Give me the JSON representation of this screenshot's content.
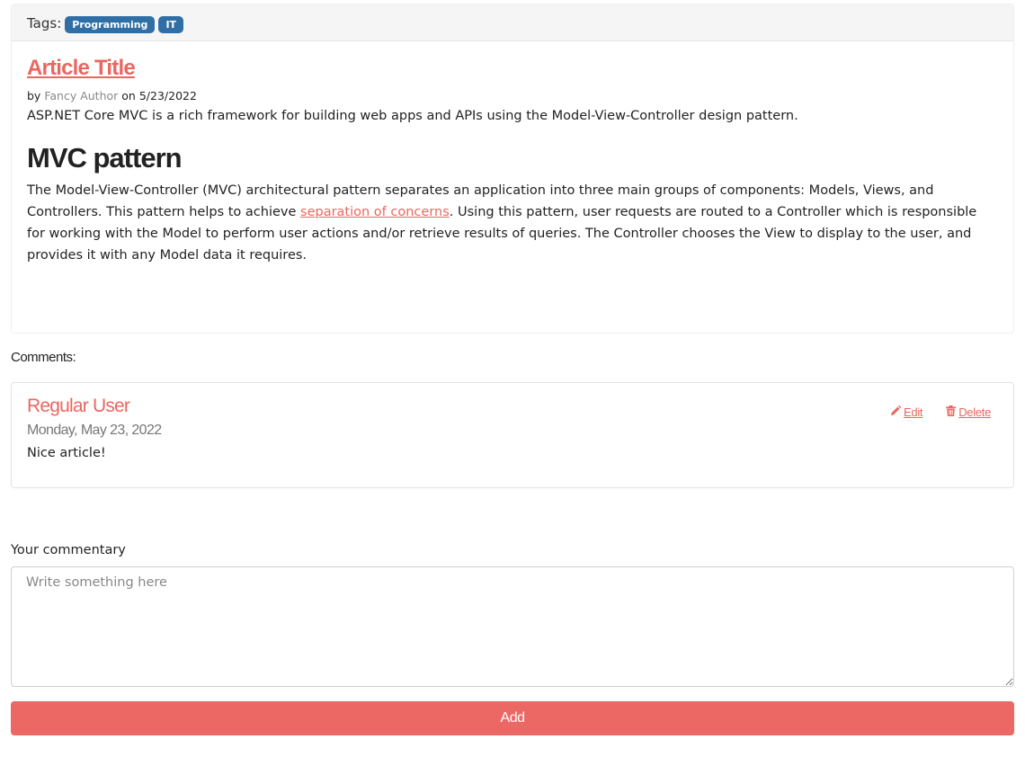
{
  "article": {
    "tags_label": "Tags:",
    "tags": [
      "Programming",
      "IT"
    ],
    "title": "Article Title",
    "byline_by": "by",
    "author": "Fancy Author",
    "byline_on": "on",
    "date": "5/23/2022",
    "summary": "ASP.NET Core MVC is a rich framework for building web apps and APIs using the Model-View-Controller design pattern.",
    "section_heading": "MVC pattern",
    "section_text_before": "The Model-View-Controller (MVC) architectural pattern separates an application into three main groups of components: Models, Views, and Controllers. This pattern helps to achieve ",
    "section_link": "separation of concerns",
    "section_text_after": ". Using this pattern, user requests are routed to a Controller which is responsible for working with the Model to perform user actions and/or retrieve results of queries. The Controller chooses the View to display to the user, and provides it with any Model data it requires."
  },
  "comments": {
    "label": "Comments:",
    "items": [
      {
        "user": "Regular User",
        "date": "Monday, May 23, 2022",
        "text": "Nice article!",
        "edit_label": "Edit",
        "delete_label": "Delete",
        "edit_icon": "pencil-icon",
        "delete_icon": "trash-icon"
      }
    ]
  },
  "form": {
    "label": "Your commentary",
    "placeholder": "Write something here",
    "value": "",
    "submit_label": "Add"
  },
  "colors": {
    "accent": "#eb6864",
    "tag": "#2f6fa5"
  }
}
